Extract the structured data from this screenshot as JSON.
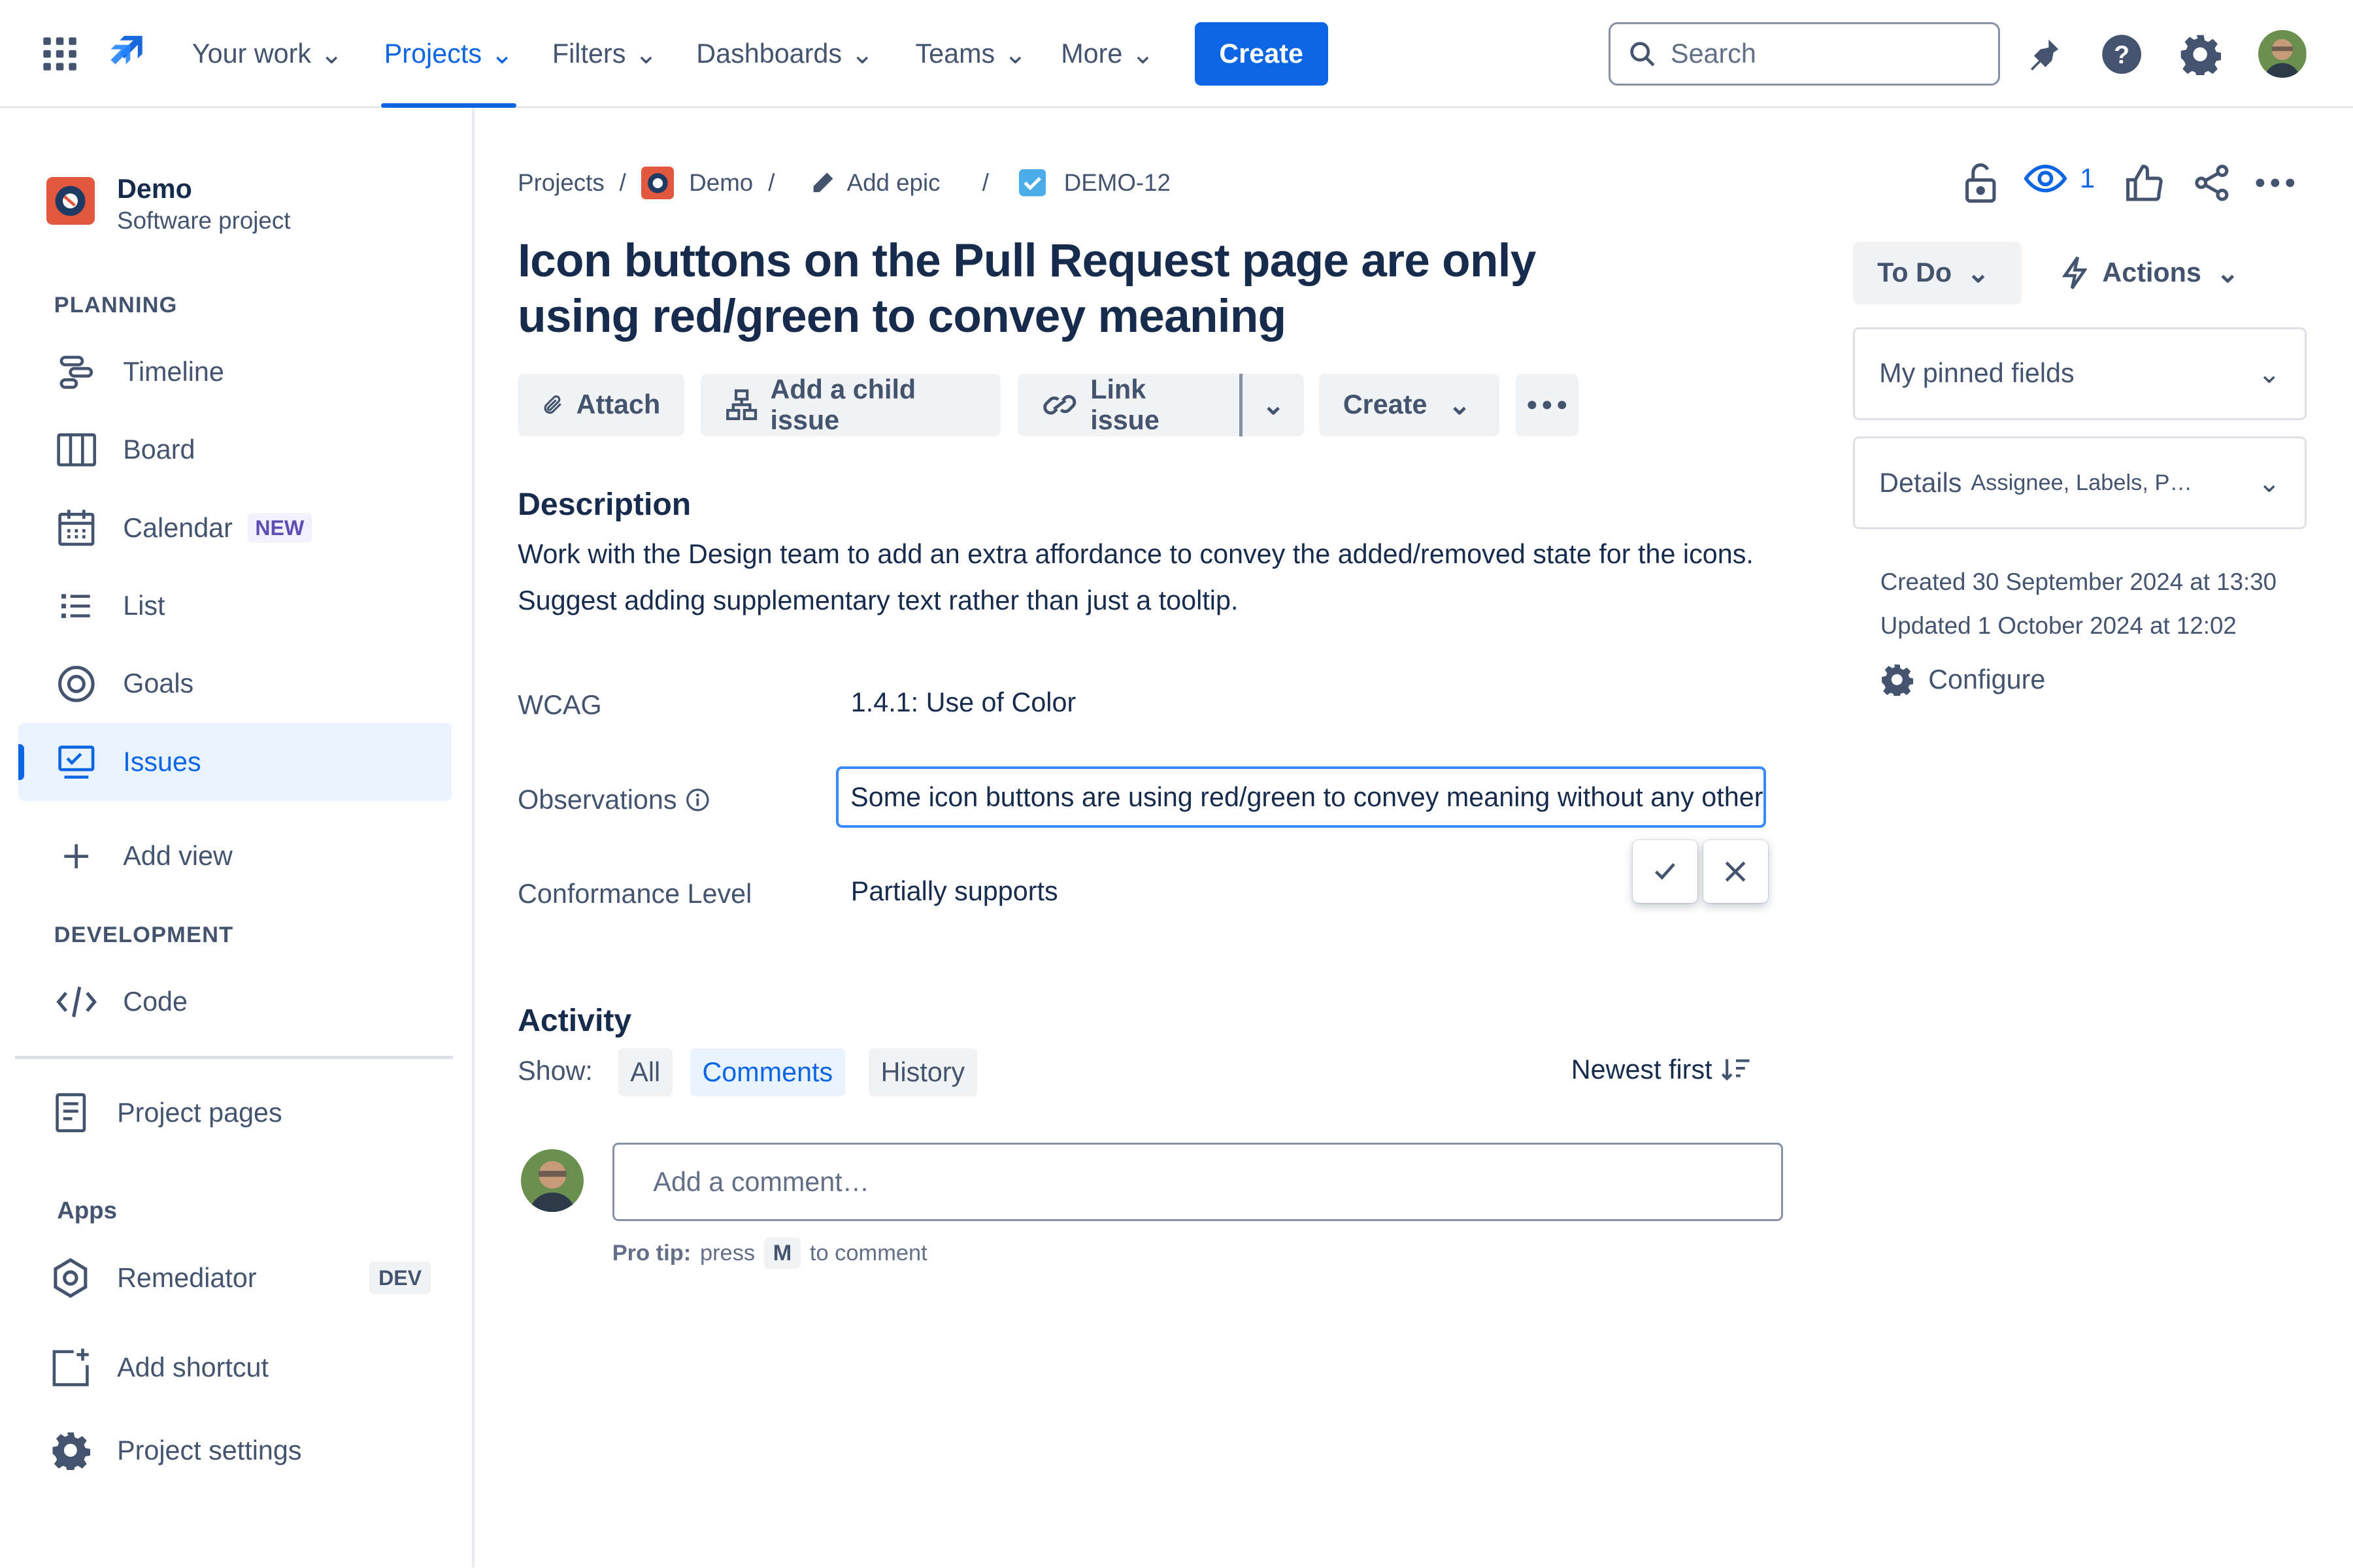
{
  "topnav": {
    "items": [
      "Your work",
      "Projects",
      "Filters",
      "Dashboards",
      "Teams",
      "More"
    ],
    "active": "Projects",
    "create_label": "Create",
    "search_placeholder": "Search"
  },
  "sidebar": {
    "project_name": "Demo",
    "project_type": "Software project",
    "planning_heading": "PLANNING",
    "planning": [
      {
        "label": "Timeline",
        "icon": "timeline-icon"
      },
      {
        "label": "Board",
        "icon": "board-icon"
      },
      {
        "label": "Calendar",
        "icon": "calendar-icon",
        "badge": "NEW"
      },
      {
        "label": "List",
        "icon": "list-icon"
      },
      {
        "label": "Goals",
        "icon": "goals-icon"
      },
      {
        "label": "Issues",
        "icon": "issues-icon",
        "selected": true
      }
    ],
    "add_view": "Add view",
    "development_heading": "DEVELOPMENT",
    "code": "Code",
    "project_pages": "Project pages",
    "apps_heading": "Apps",
    "remediator": "Remediator",
    "remediator_badge": "DEV",
    "add_shortcut": "Add shortcut",
    "project_settings": "Project settings"
  },
  "breadcrumb": {
    "projects": "Projects",
    "project": "Demo",
    "epic": "Add epic",
    "issue_key": "DEMO-12"
  },
  "issue": {
    "title": "Icon buttons on the Pull Request page are only using red/green to convey meaning",
    "toolbar": {
      "attach": "Attach",
      "add_child": "Add a child issue",
      "link_issue": "Link issue",
      "create": "Create"
    },
    "description_heading": "Description",
    "description": "Work with the Design team to add an extra affordance to convey the added/removed state for the icons. Suggest adding supplementary text rather than just a tooltip.",
    "fields": {
      "wcag_label": "WCAG",
      "wcag_value": "1.4.1: Use of Color",
      "observations_label": "Observations",
      "observations_value": "Some icon buttons are using red/green to convey meaning without any other",
      "conformance_label": "Conformance Level",
      "conformance_value": "Partially supports"
    }
  },
  "activity": {
    "heading": "Activity",
    "show_label": "Show:",
    "filters": [
      "All",
      "Comments",
      "History"
    ],
    "active_filter": "Comments",
    "sort": "Newest first",
    "comment_placeholder": "Add a comment…",
    "protip_bold": "Pro tip:",
    "protip_press": "press",
    "protip_key": "M",
    "protip_rest": "to comment"
  },
  "right_panel": {
    "watch_count": "1",
    "status": "To Do",
    "actions": "Actions",
    "pinned_fields": "My pinned fields",
    "details": "Details",
    "details_hint": "Assignee, Labels, P…",
    "created": "Created 30 September 2024 at 13:30",
    "updated": "Updated 1 October 2024 at 12:02",
    "configure": "Configure"
  },
  "colors": {
    "brand_blue": "#0c66e4",
    "text": "#172b4d",
    "subtle_text": "#44546f",
    "selected_bg": "#e9f2ff"
  }
}
